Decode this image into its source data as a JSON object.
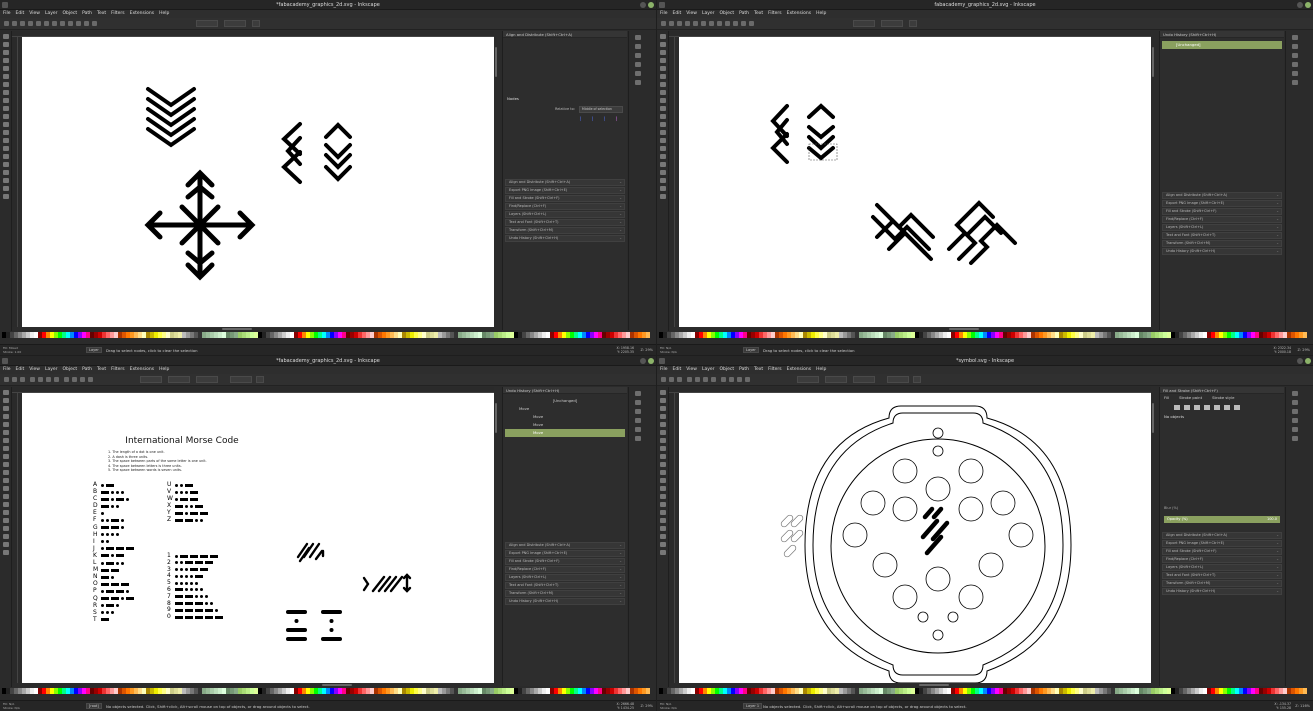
{
  "menu": [
    "File",
    "Edit",
    "View",
    "Layer",
    "Object",
    "Path",
    "Text",
    "Filters",
    "Extensions",
    "Help"
  ],
  "windows": [
    {
      "title": "*fabacademy_graphics_2d.svg - Inkscape",
      "dock_header": "Align and Distribute (Shift+Ctrl+A)",
      "align_panel": {
        "nodes_label": "Nodes",
        "relative_to_label": "Relative to:",
        "relative_to_value": "Middle of selection"
      },
      "dialogs": [
        "Align and Distribute (Shift+Ctrl+A)",
        "Export PNG Image (Shift+Ctrl+E)",
        "Fill and Stroke (Shift+Ctrl+F)",
        "Find/Replace (Ctrl+F)",
        "Layers (Shift+Ctrl+L)",
        "Text and Font (Shift+Ctrl+T)",
        "Transform (Shift+Ctrl+M)",
        "Undo History (Shift+Ctrl+H)"
      ],
      "status": {
        "fill_label": "Fill:",
        "stroke_label": "Stroke:",
        "fill_value": "Mixed",
        "stroke_value": "1.00",
        "layer": "Layer",
        "message": "Drag to select nodes, click to clear the selection",
        "coords": "X: 1958.16\nY: 2205.35",
        "zoom": "Z: 29%"
      }
    },
    {
      "title": "fabacademy_graphics_2d.svg - Inkscape",
      "dock_header": "Undo History (Shift+Ctrl+H)",
      "history": [
        "[Unchanged]"
      ],
      "dialogs": [
        "Align and Distribute (Shift+Ctrl+A)",
        "Export PNG Image (Shift+Ctrl+E)",
        "Fill and Stroke (Shift+Ctrl+F)",
        "Find/Replace (Ctrl+F)",
        "Layers (Shift+Ctrl+L)",
        "Text and Font (Shift+Ctrl+T)",
        "Transform (Shift+Ctrl+M)",
        "Undo History (Shift+Ctrl+H)"
      ],
      "status": {
        "fill_label": "Fill:",
        "stroke_label": "Stroke:",
        "fill_value": "N/A",
        "stroke_value": "N/A",
        "layer": "Layer",
        "message": "Drag to select nodes, click to clear the selection",
        "coords": "X: 2322.34\nY: 2000.18",
        "zoom": "Z: 29%"
      }
    },
    {
      "title": "*fabacademy_graphics_2d.svg - Inkscape",
      "dock_header": "Undo History (Shift+Ctrl+H)",
      "history": [
        "[Unchanged]",
        "Move",
        "Move",
        "Move",
        "Move"
      ],
      "dialogs": [
        "Align and Distribute (Shift+Ctrl+A)",
        "Export PNG Image (Shift+Ctrl+E)",
        "Fill and Stroke (Shift+Ctrl+F)",
        "Find/Replace (Ctrl+F)",
        "Layers (Shift+Ctrl+L)",
        "Text and Font (Shift+Ctrl+T)",
        "Transform (Shift+Ctrl+M)",
        "Undo History (Shift+Ctrl+H)"
      ],
      "morse": {
        "title": "International Morse Code",
        "rules": [
          "1. The length of a dot is one unit.",
          "2. A dash is three units.",
          "3. The space between parts of the same letter is one unit.",
          "4. The space between letters is three units.",
          "5. The space between words is seven units."
        ],
        "letters_a": [
          "A",
          "B",
          "C",
          "D",
          "E",
          "F",
          "G",
          "H",
          "I",
          "J",
          "K",
          "L",
          "M",
          "N",
          "O",
          "P",
          "Q",
          "R",
          "S",
          "T"
        ],
        "letters_b": [
          "U",
          "V",
          "W",
          "X",
          "Y",
          "Z"
        ],
        "digits": [
          "1",
          "2",
          "3",
          "4",
          "5",
          "6",
          "7",
          "8",
          "9",
          "0"
        ]
      },
      "status": {
        "fill_label": "Fill:",
        "stroke_label": "Stroke:",
        "fill_value": "N/A",
        "stroke_value": "N/A",
        "layer": "[root]",
        "message": "No objects selected. Click, Shift+click, Alt+scroll mouse on top of objects, or drag around objects to select.",
        "coords": "X: 2666.48\nY: 1434.25",
        "zoom": "Z: 29%"
      }
    },
    {
      "title": "*symbol.svg - Inkscape",
      "dock_header": "Fill and Stroke (Shift+Ctrl+F)",
      "fill_tabs": [
        "Fill",
        "Stroke paint",
        "Stroke style"
      ],
      "no_objects": "No objects",
      "blur_label": "Blur (%)",
      "opacity_label": "Opacity (%)",
      "opacity_value": "100.0",
      "dialogs": [
        "Align and Distribute (Shift+Ctrl+A)",
        "Export PNG Image (Shift+Ctrl+E)",
        "Fill and Stroke (Shift+Ctrl+F)",
        "Find/Replace (Ctrl+F)",
        "Layers (Shift+Ctrl+L)",
        "Text and Font (Shift+Ctrl+T)",
        "Transform (Shift+Ctrl+M)",
        "Undo History (Shift+Ctrl+H)"
      ],
      "status": {
        "fill_label": "Fill:",
        "stroke_label": "Stroke:",
        "fill_value": "N/A",
        "stroke_value": "N/A",
        "layer": "Layer 1",
        "message": "No objects selected. Click, Shift+click, Alt+scroll mouse on top of objects, or drag around objects to select.",
        "coords": "X: -134.37\nY: 155.28",
        "zoom": "Z: 116%"
      }
    }
  ],
  "colors": {
    "chrome": "#2b2b2b",
    "selection": "#8aa05f",
    "canvas": "#ffffff"
  }
}
